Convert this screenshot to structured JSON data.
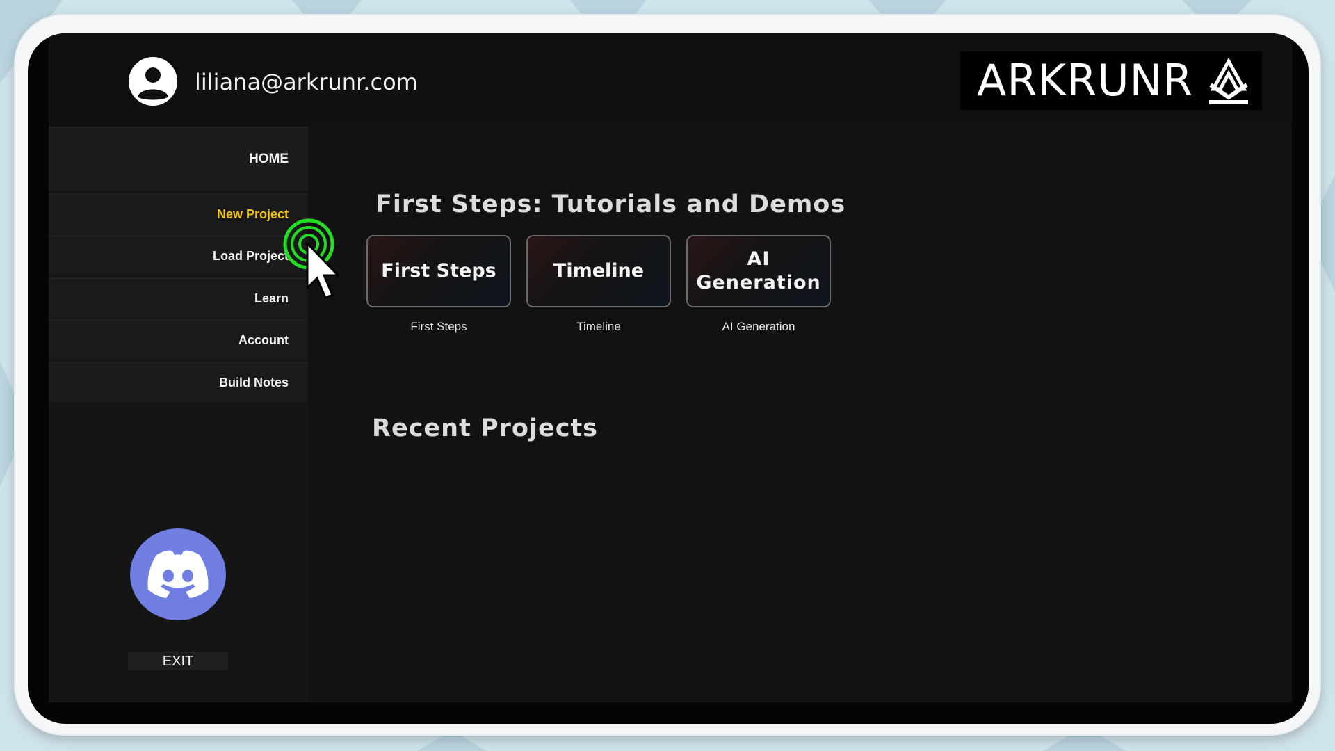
{
  "header": {
    "user_email": "liliana@arkrunr.com",
    "logo_text": "ARKRUNR"
  },
  "sidebar": {
    "items": [
      {
        "label": "HOME",
        "state": "default"
      },
      {
        "label": "New Project",
        "state": "active"
      },
      {
        "label": "Load Project",
        "state": "default"
      },
      {
        "label": "Learn",
        "state": "default"
      },
      {
        "label": "Account",
        "state": "default"
      },
      {
        "label": "Build Notes",
        "state": "default"
      }
    ],
    "discord_icon": "discord-icon",
    "exit_label": "EXIT"
  },
  "main": {
    "tutorials_title": "First Steps: Tutorials and Demos",
    "tutorial_cards": [
      {
        "label": "First Steps",
        "caption": "First Steps"
      },
      {
        "label": "Timeline",
        "caption": "Timeline"
      },
      {
        "label": "AI Generation",
        "caption": "AI Generation"
      }
    ],
    "recent_title": "Recent Projects"
  },
  "colors": {
    "active_nav": "#f2c20a",
    "discord": "#6f7ee0",
    "click_indicator": "#22dd22"
  }
}
